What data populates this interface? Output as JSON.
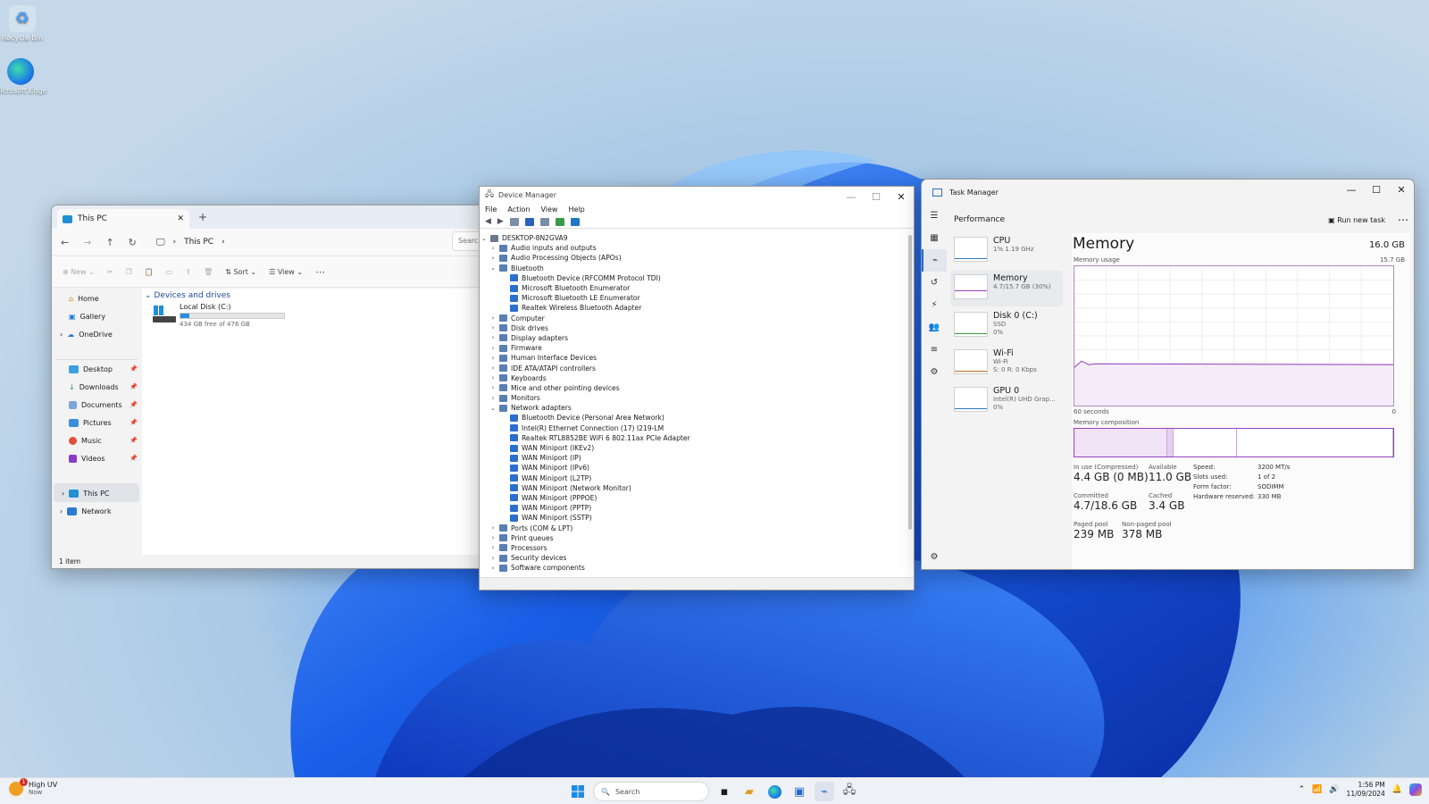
{
  "desktop": {
    "icons": [
      {
        "label": "Recycle Bin",
        "icon": "recycle-bin-icon"
      },
      {
        "label": "Microsoft Edge",
        "icon": "edge-icon"
      }
    ]
  },
  "explorer": {
    "tab_title": "This PC",
    "breadcrumb": "This PC",
    "search_placeholder": "Search",
    "toolbar": {
      "new": "New",
      "sort": "Sort",
      "view": "View"
    },
    "nav": {
      "top": [
        "Home",
        "Gallery",
        "OneDrive"
      ],
      "quick": [
        "Desktop",
        "Downloads",
        "Documents",
        "Pictures",
        "Music",
        "Videos"
      ],
      "bottom": [
        "This PC",
        "Network"
      ]
    },
    "section": "Devices and drives",
    "drive": {
      "name": "Local Disk (C:)",
      "free": "434 GB free of 476 GB",
      "used_fraction": 0.09
    },
    "status": "1 item"
  },
  "device_manager": {
    "title": "Device Manager",
    "menu": [
      "File",
      "Action",
      "View",
      "Help"
    ],
    "root": "DESKTOP-8N2GVA9",
    "tree": [
      {
        "label": "Audio inputs and outputs",
        "level": 1,
        "exp": ">"
      },
      {
        "label": "Audio Processing Objects (APOs)",
        "level": 1,
        "exp": ">"
      },
      {
        "label": "Bluetooth",
        "level": 1,
        "exp": "v"
      },
      {
        "label": "Bluetooth Device (RFCOMM Protocol TDI)",
        "level": 2,
        "exp": ""
      },
      {
        "label": "Microsoft Bluetooth Enumerator",
        "level": 2,
        "exp": ""
      },
      {
        "label": "Microsoft Bluetooth LE Enumerator",
        "level": 2,
        "exp": ""
      },
      {
        "label": "Realtek Wireless Bluetooth Adapter",
        "level": 2,
        "exp": ""
      },
      {
        "label": "Computer",
        "level": 1,
        "exp": ">"
      },
      {
        "label": "Disk drives",
        "level": 1,
        "exp": ">"
      },
      {
        "label": "Display adapters",
        "level": 1,
        "exp": ">"
      },
      {
        "label": "Firmware",
        "level": 1,
        "exp": ">"
      },
      {
        "label": "Human Interface Devices",
        "level": 1,
        "exp": ">"
      },
      {
        "label": "IDE ATA/ATAPI controllers",
        "level": 1,
        "exp": ">"
      },
      {
        "label": "Keyboards",
        "level": 1,
        "exp": ">"
      },
      {
        "label": "Mice and other pointing devices",
        "level": 1,
        "exp": ">"
      },
      {
        "label": "Monitors",
        "level": 1,
        "exp": ">"
      },
      {
        "label": "Network adapters",
        "level": 1,
        "exp": "v"
      },
      {
        "label": "Bluetooth Device (Personal Area Network)",
        "level": 2,
        "exp": ""
      },
      {
        "label": "Intel(R) Ethernet Connection (17) I219-LM",
        "level": 2,
        "exp": ""
      },
      {
        "label": "Realtek RTL8852BE WiFi 6 802.11ax PCIe Adapter",
        "level": 2,
        "exp": ""
      },
      {
        "label": "WAN Miniport (IKEv2)",
        "level": 2,
        "exp": ""
      },
      {
        "label": "WAN Miniport (IP)",
        "level": 2,
        "exp": ""
      },
      {
        "label": "WAN Miniport (IPv6)",
        "level": 2,
        "exp": ""
      },
      {
        "label": "WAN Miniport (L2TP)",
        "level": 2,
        "exp": ""
      },
      {
        "label": "WAN Miniport (Network Monitor)",
        "level": 2,
        "exp": ""
      },
      {
        "label": "WAN Miniport (PPPOE)",
        "level": 2,
        "exp": ""
      },
      {
        "label": "WAN Miniport (PPTP)",
        "level": 2,
        "exp": ""
      },
      {
        "label": "WAN Miniport (SSTP)",
        "level": 2,
        "exp": ""
      },
      {
        "label": "Ports (COM & LPT)",
        "level": 1,
        "exp": ">"
      },
      {
        "label": "Print queues",
        "level": 1,
        "exp": ">"
      },
      {
        "label": "Processors",
        "level": 1,
        "exp": ">"
      },
      {
        "label": "Security devices",
        "level": 1,
        "exp": ">"
      },
      {
        "label": "Software components",
        "level": 1,
        "exp": ">"
      }
    ]
  },
  "task_manager": {
    "title": "Task Manager",
    "page": "Performance",
    "run_new_task": "Run new task",
    "items": [
      {
        "name": "CPU",
        "sub1": "1% 1.19 GHz",
        "sub2": ""
      },
      {
        "name": "Memory",
        "sub1": "4.7/15.7 GB (30%)",
        "sub2": ""
      },
      {
        "name": "Disk 0 (C:)",
        "sub1": "SSD",
        "sub2": "0%"
      },
      {
        "name": "Wi-Fi",
        "sub1": "Wi-Fi",
        "sub2": "S: 0 R: 0 Kbps"
      },
      {
        "name": "GPU 0",
        "sub1": "Intel(R) UHD Grap...",
        "sub2": "0%"
      }
    ],
    "memory": {
      "heading": "Memory",
      "total": "16.0 GB",
      "usage_label": "Memory usage",
      "usage_max": "15.7 GB",
      "usage_fraction": 0.3,
      "time_left": "60 seconds",
      "time_right": "0",
      "composition_label": "Memory composition",
      "composition": [
        0.29,
        0.02,
        0.2,
        0.49
      ],
      "stats": [
        {
          "label": "In use (Compressed)",
          "value": "4.4 GB (0 MB)"
        },
        {
          "label": "Available",
          "value": "11.0 GB"
        },
        {
          "label": "Committed",
          "value": "4.7/18.6 GB"
        },
        {
          "label": "Cached",
          "value": "3.4 GB"
        },
        {
          "label": "Paged pool",
          "value": "239 MB"
        },
        {
          "label": "Non-paged pool",
          "value": "378 MB"
        }
      ],
      "details": [
        {
          "label": "Speed:",
          "value": "3200 MT/s"
        },
        {
          "label": "Slots used:",
          "value": "1 of 2"
        },
        {
          "label": "Form factor:",
          "value": "SODIMM"
        },
        {
          "label": "Hardware reserved:",
          "value": "330 MB"
        }
      ]
    }
  },
  "taskbar": {
    "weather": {
      "title": "High UV",
      "sub": "Now",
      "badge": "1"
    },
    "search_placeholder": "Search",
    "time": "1:56 PM",
    "date": "11/09/2024"
  }
}
